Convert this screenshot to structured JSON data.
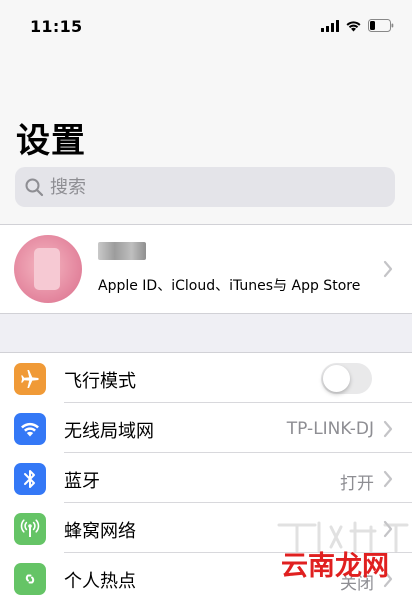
{
  "status_bar": {
    "time": "11:15"
  },
  "page": {
    "title": "设置"
  },
  "search": {
    "placeholder": "搜索"
  },
  "profile": {
    "subtitle": "Apple ID、iCloud、iTunes与 App Store"
  },
  "settings": [
    {
      "label": "飞行模式",
      "icon": "airplane-icon",
      "color": "#f09a37",
      "control": "toggle",
      "toggle_on": false
    },
    {
      "label": "无线局域网",
      "icon": "wifi-icon",
      "color": "#3478f6",
      "value": "TP-LINK-DJ"
    },
    {
      "label": "蓝牙",
      "icon": "bluetooth-icon",
      "color": "#3478f6",
      "value": "打开"
    },
    {
      "label": "蜂窝网络",
      "icon": "cellular-icon",
      "color": "#65c466"
    },
    {
      "label": "个人热点",
      "icon": "hotspot-icon",
      "color": "#65c466",
      "value": "关闭"
    }
  ],
  "watermark": {
    "text": "云南龙网"
  }
}
